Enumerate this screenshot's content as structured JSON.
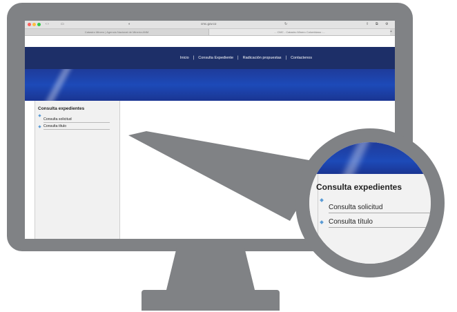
{
  "browser": {
    "url": "cmc.gov.co",
    "tabs": [
      {
        "label": "Catastro Minero | Agencia Nacional de Minería ANM"
      },
      {
        "label": "... CMC - Catastro Minero Colombiano :..."
      }
    ]
  },
  "site": {
    "nav": [
      {
        "label": "Inicio"
      },
      {
        "label": "Consulta Expediente"
      },
      {
        "label": "Radicación propuestas"
      },
      {
        "label": "Contactenos"
      }
    ],
    "sidebar": {
      "title": "Consulta expedientes",
      "items": [
        {
          "label": "Consulta solicitud"
        },
        {
          "label": "Consulta título"
        }
      ]
    }
  },
  "magnifier": {
    "title": "Consulta expedientes",
    "items": [
      {
        "label": "Consulta solicitud"
      },
      {
        "label": "Consulta título"
      }
    ]
  },
  "colors": {
    "monitor": "#808285",
    "navbar": "#1d2f68",
    "banner": "#1d4ab8",
    "bullet": "#5b9bd5"
  }
}
